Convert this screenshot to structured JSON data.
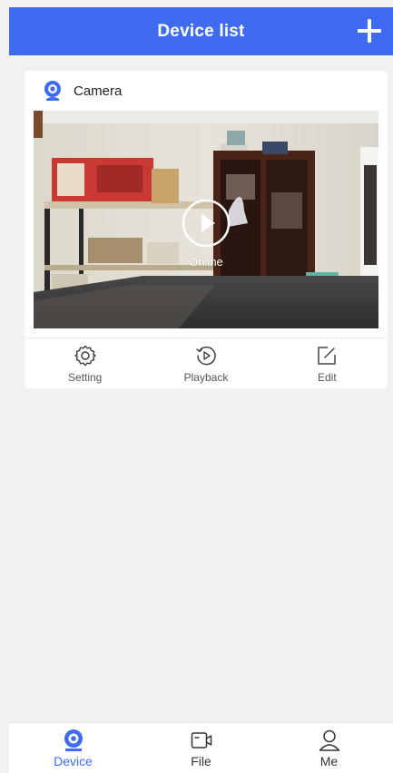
{
  "header": {
    "title": "Device list"
  },
  "device_card": {
    "name": "Camera",
    "status": "Online",
    "actions": [
      {
        "label": "Setting",
        "icon": "gear-icon"
      },
      {
        "label": "Playback",
        "icon": "playback-icon"
      },
      {
        "label": "Edit",
        "icon": "edit-icon"
      }
    ]
  },
  "bottom_nav": {
    "items": [
      {
        "label": "Device",
        "icon": "camera-icon",
        "active": true
      },
      {
        "label": "File",
        "icon": "video-file-icon",
        "active": false
      },
      {
        "label": "Me",
        "icon": "user-icon",
        "active": false
      }
    ]
  },
  "colors": {
    "accent": "#3f6bf0",
    "background": "#f1f1f1",
    "card": "#ffffff"
  }
}
